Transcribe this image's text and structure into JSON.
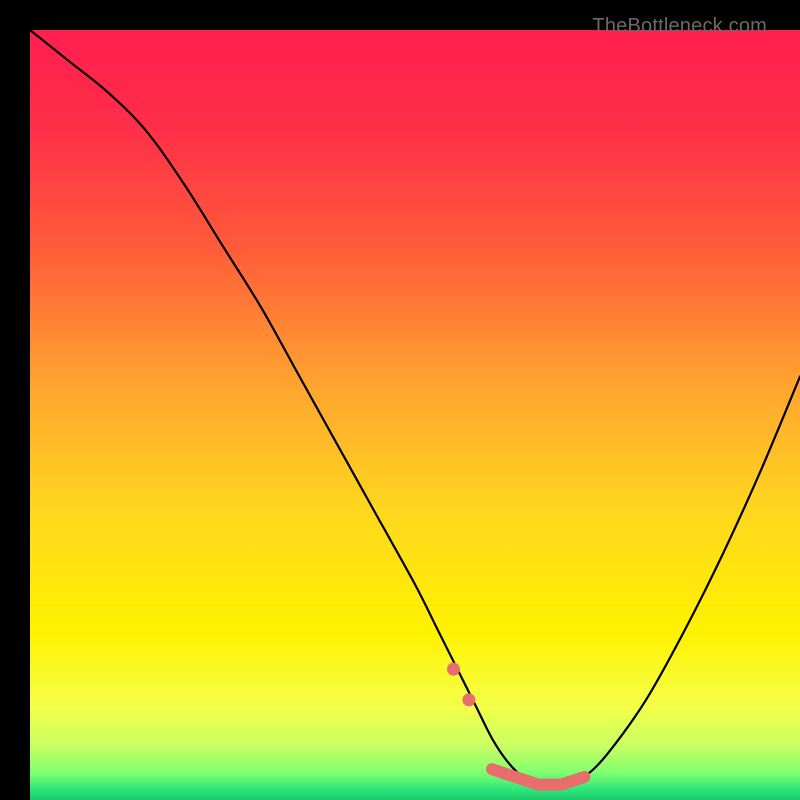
{
  "watermark": "TheBottleneck.com",
  "colors": {
    "background": "#000000",
    "gradient_stops": [
      {
        "offset": 0.0,
        "color": "#ff1f4f"
      },
      {
        "offset": 0.12,
        "color": "#ff2d49"
      },
      {
        "offset": 0.28,
        "color": "#ff5a3a"
      },
      {
        "offset": 0.45,
        "color": "#ffa030"
      },
      {
        "offset": 0.62,
        "color": "#ffd61f"
      },
      {
        "offset": 0.78,
        "color": "#fff200"
      },
      {
        "offset": 0.88,
        "color": "#f4ff4a"
      },
      {
        "offset": 0.93,
        "color": "#c8ff62"
      },
      {
        "offset": 0.965,
        "color": "#7fff70"
      },
      {
        "offset": 0.985,
        "color": "#32e87a"
      },
      {
        "offset": 1.0,
        "color": "#18c86a"
      }
    ],
    "curve": "#000000",
    "marker": "#e86e6e"
  },
  "chart_data": {
    "type": "line",
    "title": "",
    "xlabel": "",
    "ylabel": "",
    "xlim": [
      0,
      100
    ],
    "ylim": [
      0,
      100
    ],
    "series": [
      {
        "name": "bottleneck-curve",
        "x": [
          0,
          5,
          10,
          15,
          20,
          25,
          30,
          35,
          40,
          45,
          50,
          53,
          56,
          58,
          60,
          62,
          64,
          66,
          68,
          70,
          72,
          75,
          80,
          85,
          90,
          95,
          100
        ],
        "values": [
          100,
          96,
          92,
          87,
          80,
          72,
          64,
          55,
          46,
          37,
          28,
          22,
          16,
          12,
          8,
          5,
          3,
          2,
          2,
          2,
          3,
          6,
          13,
          22,
          32,
          43,
          55
        ]
      }
    ],
    "markers": {
      "name": "optimal-range",
      "x": [
        55,
        57,
        60,
        63,
        66,
        69,
        72
      ],
      "values": [
        17,
        13,
        4,
        3,
        2,
        2,
        3
      ]
    }
  }
}
